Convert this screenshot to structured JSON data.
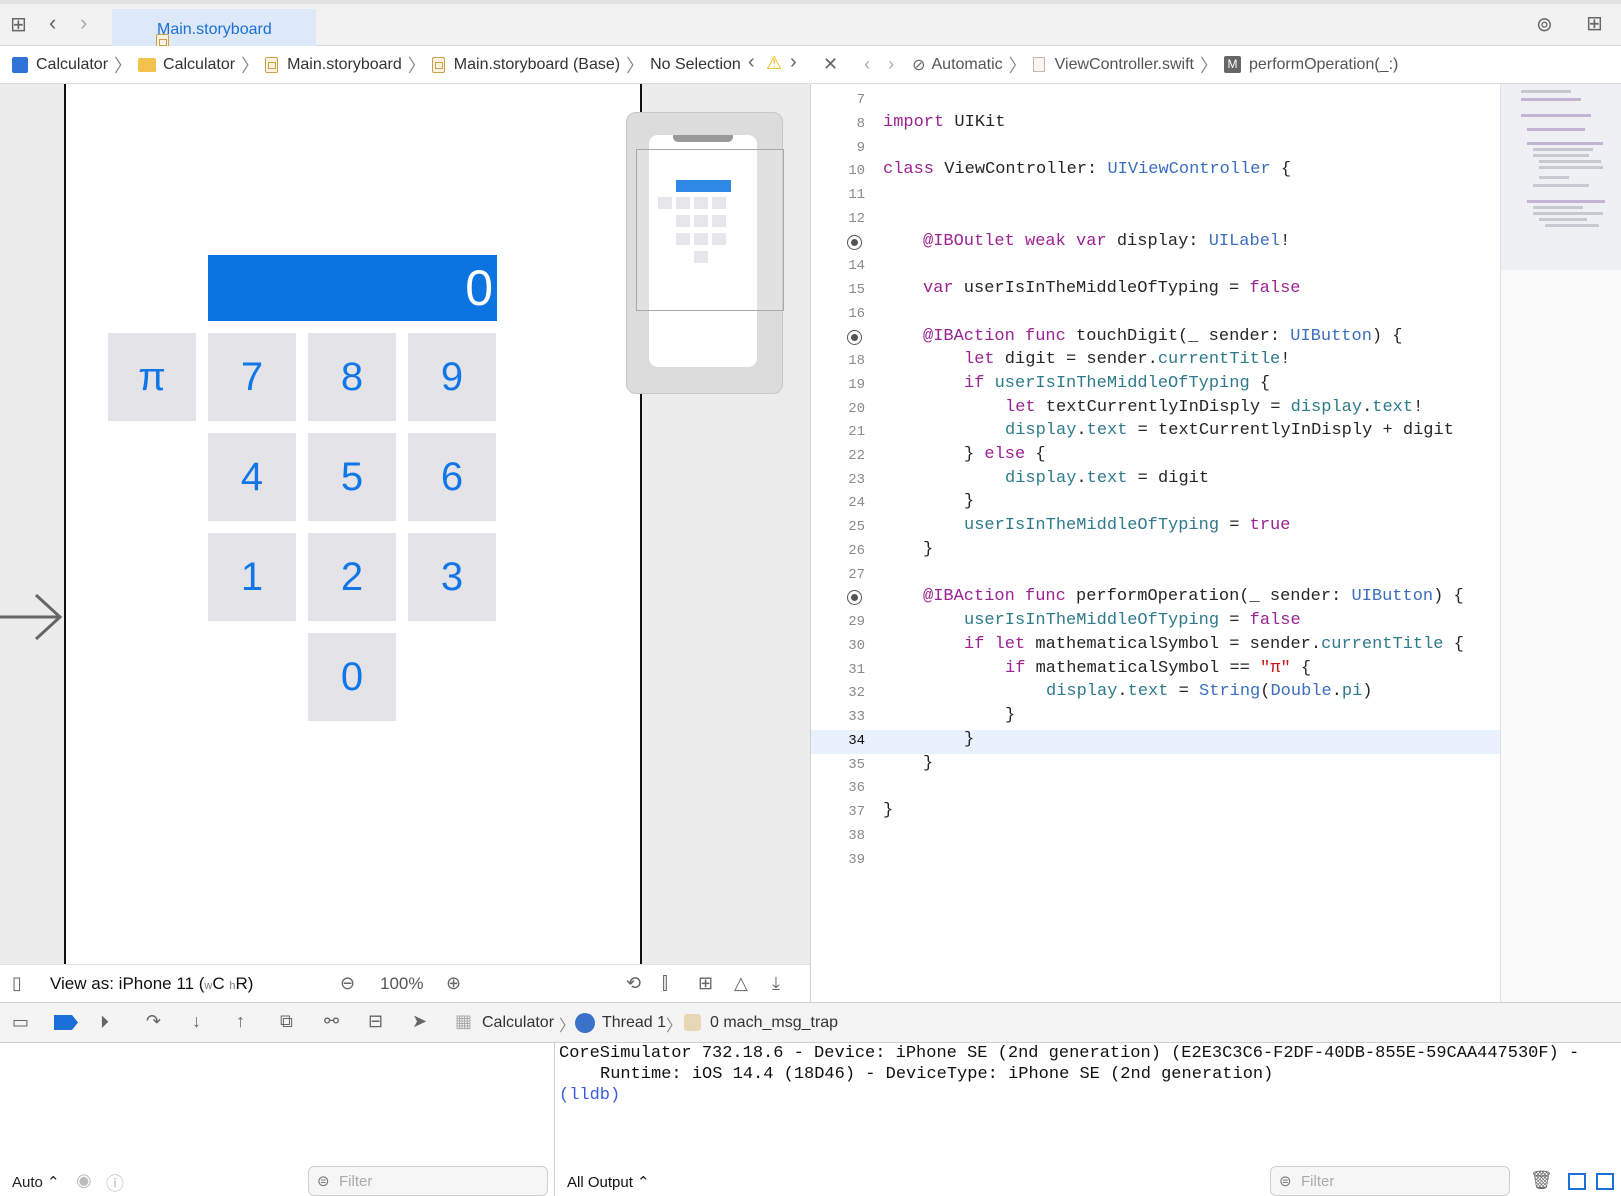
{
  "tab": {
    "label": "Main.storyboard"
  },
  "left_crumbs": {
    "c1": "Calculator",
    "c2": "Calculator",
    "c3": "Main.storyboard",
    "c4": "Main.storyboard (Base)",
    "c5": "No Selection"
  },
  "right_crumbs": {
    "c1": "Automatic",
    "c2": "ViewController.swift",
    "c3": "performOperation(_:)"
  },
  "calc": {
    "display": "0",
    "keys": {
      "pi": "π",
      "k7": "7",
      "k8": "8",
      "k9": "9",
      "k4": "4",
      "k5": "5",
      "k6": "6",
      "k1": "1",
      "k2": "2",
      "k3": "3",
      "k0": "0"
    }
  },
  "canvas_bar": {
    "view_as": "View as: iPhone 11 (",
    "w": "w",
    "c": "C",
    "h": "h",
    "r": "R)",
    "zoom": "100%"
  },
  "code": {
    "lines": [
      "7",
      "8",
      "9",
      "10",
      "11",
      "12",
      "14",
      "15",
      "16",
      "18",
      "19",
      "20",
      "21",
      "22",
      "23",
      "24",
      "25",
      "26",
      "27",
      "29",
      "30",
      "31",
      "32",
      "33",
      "34",
      "35",
      "36",
      "37",
      "38",
      "39"
    ],
    "l8": [
      "import",
      " UIKit"
    ],
    "l10": [
      "class",
      " ViewController: ",
      "UIViewController",
      " {"
    ],
    "l13": [
      "@IBOutlet",
      " ",
      "weak",
      " ",
      "var",
      " display: ",
      "UILabel",
      "!"
    ],
    "l15": [
      "var",
      " userIsInTheMiddleOfTyping = ",
      "false"
    ],
    "l17": [
      "@IBAction",
      " ",
      "func",
      " touchDigit(_ sender: ",
      "UIButton",
      ") {"
    ],
    "l18": [
      "let",
      " digit = sender.",
      "currentTitle",
      "!"
    ],
    "l19": [
      "if",
      " ",
      "userIsInTheMiddleOfTyping",
      " {"
    ],
    "l20": [
      "let",
      " textCurrentlyInDisply = ",
      "display",
      ".",
      "text",
      "!"
    ],
    "l21": [
      "display",
      ".",
      "text",
      " = textCurrentlyInDisply + digit"
    ],
    "l22": [
      "} ",
      "else",
      " {"
    ],
    "l23": [
      "display",
      ".",
      "text",
      " = digit"
    ],
    "l24": "}",
    "l25": [
      "userIsInTheMiddleOfTyping",
      " = ",
      "true"
    ],
    "l26": "}",
    "l28": [
      "@IBAction",
      " ",
      "func",
      " performOperation(_ sender: ",
      "UIButton",
      ") {"
    ],
    "l29": [
      "userIsInTheMiddleOfTyping",
      " = ",
      "false"
    ],
    "l30": [
      "if",
      " ",
      "let",
      " mathematicalSymbol = sender.",
      "currentTitle",
      " {"
    ],
    "l31": [
      "if",
      " mathematicalSymbol == ",
      "\"π\"",
      " {"
    ],
    "l32": [
      "display",
      ".",
      "text",
      " = ",
      "String",
      "(",
      "Double",
      ".",
      "pi",
      ")"
    ],
    "l33": "}",
    "l34": "}",
    "l35": "}",
    "l37": "}"
  },
  "debug": {
    "target": "Calculator",
    "thread": "Thread 1",
    "frame": "0 mach_msg_trap"
  },
  "console": {
    "line1": "CoreSimulator 732.18.6 - Device: iPhone SE (2nd generation) (E2E3C3C6-F2DF-40DB-855E-59CAA447530F) -",
    "line2": "Runtime: iOS 14.4 (18D46) - DeviceType: iPhone SE (2nd generation)",
    "prompt": "(lldb)"
  },
  "bottom": {
    "auto": "Auto ⌃",
    "filter": "Filter",
    "all_output": "All Output ⌃",
    "filter2": "Filter"
  },
  "colors": {
    "accent": "#1a6fd9",
    "keyword": "#9b2393",
    "type": "#3b6ec0",
    "property": "#2e7a8b",
    "string": "#c41a16",
    "display_bg": "#0b74e0",
    "warning": "#f0b400"
  }
}
